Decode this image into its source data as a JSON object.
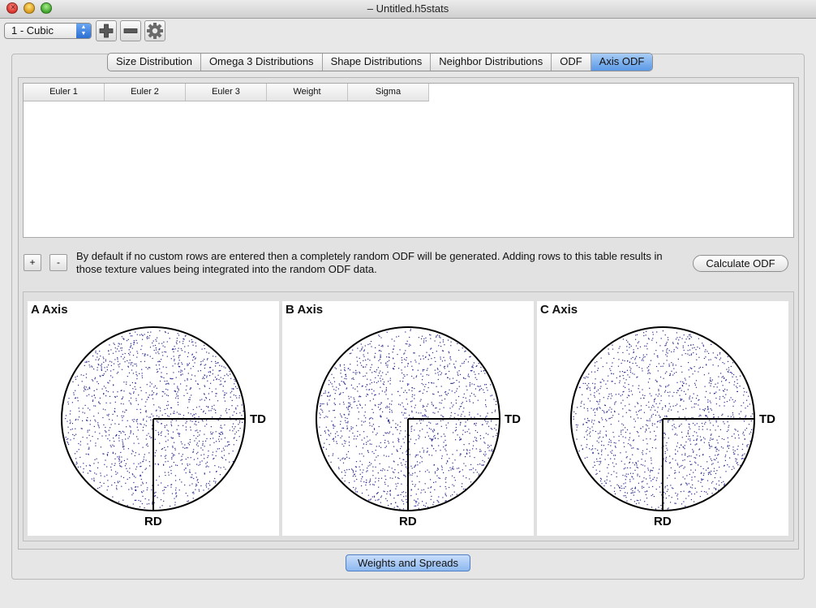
{
  "window": {
    "title": "– Untitled.h5stats"
  },
  "toolbar": {
    "phase_select": "1 - Cubic",
    "add_icon": "plus-icon",
    "remove_icon": "minus-icon",
    "settings_icon": "gear-icon"
  },
  "tabs": [
    {
      "label": "Size Distribution"
    },
    {
      "label": "Omega 3 Distributions"
    },
    {
      "label": "Shape Distributions"
    },
    {
      "label": "Neighbor Distributions"
    },
    {
      "label": "ODF"
    },
    {
      "label": "Axis ODF",
      "active": true
    }
  ],
  "table": {
    "columns": [
      "Euler 1",
      "Euler 2",
      "Euler 3",
      "Weight",
      "Sigma"
    ],
    "rows": []
  },
  "row_buttons": {
    "add": "+",
    "remove": "-"
  },
  "info_text": "By default if no custom rows are entered then a completely random ODF will be generated. Adding rows to this table results in those texture values being integrated into the random ODF data.",
  "calculate_button": "Calculate ODF",
  "pole_figures": [
    {
      "title": "A Axis",
      "td_label": "TD",
      "rd_label": "RD"
    },
    {
      "title": "B Axis",
      "td_label": "TD",
      "rd_label": "RD"
    },
    {
      "title": "C Axis",
      "td_label": "TD",
      "rd_label": "RD"
    }
  ],
  "dot_color": "#2b2b8f",
  "weights_button": "Weights and Spreads"
}
